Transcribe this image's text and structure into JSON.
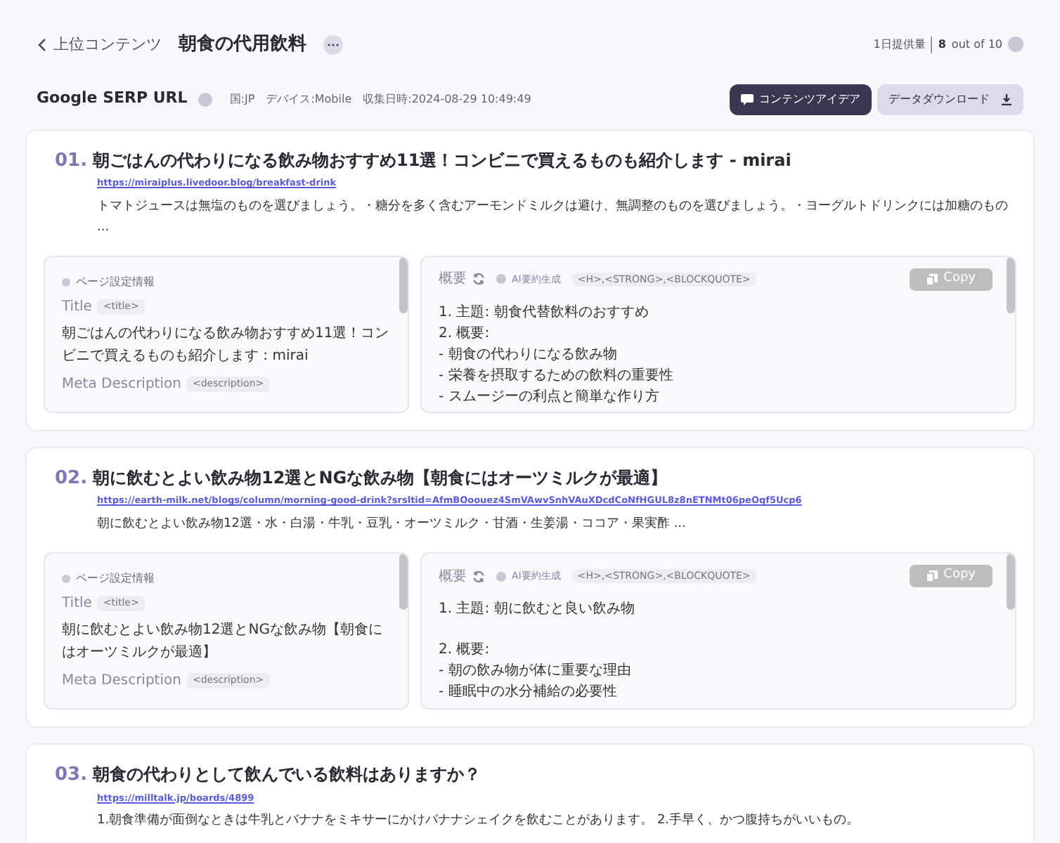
{
  "header": {
    "back_label": "上位コンテンツ",
    "title": "朝食の代用飲料",
    "quota_label": "1日提供量",
    "quota_used": "8",
    "quota_total": "out of 10"
  },
  "serp": {
    "title": "Google SERP URL",
    "country": "国:JP",
    "device": "デバイス:Mobile",
    "collected": "収集日時:2024-08-29 10:49:49",
    "idea_button": "コンテンツアイデア",
    "download_button": "データダウンロード"
  },
  "results": [
    {
      "rank": "01.",
      "title": "朝ごはんの代わりになる飲み物おすすめ11選！コンビニで買えるものも紹介します - mirai",
      "url": "https://miraiplus.livedoor.blog/breakfast-drink",
      "snippet": "トマトジュースは無塩のものを選びましょう。・糖分を多く含むアーモンドミルクは避け、無調整のものを選びましょう。・ヨーグルトドリンクには加糖のもの ...",
      "page_info": {
        "label": "ページ設定情報",
        "title_label": "Title",
        "title_tag": "<title>",
        "title_text": "朝ごはんの代わりになる飲み物おすすめ11選！コンビニで買えるものも紹介します : mirai",
        "meta_label": "Meta Description",
        "meta_tag": "<description>"
      },
      "summary": {
        "label": "概要",
        "ai_label": "AI要約生成",
        "tags": "<H>,<STRONG>,<BLOCKQUOTE>",
        "copy": "Copy",
        "paragraphs": [
          [
            "1. 主題: 朝食代替飲料のおすすめ",
            "2. 概要:",
            "- 朝食の代わりになる飲み物",
            "- 栄養を摂取するための飲料の重要性",
            "- スムージーの利点と簡単な作り方"
          ]
        ]
      }
    },
    {
      "rank": "02.",
      "title": "朝に飲むとよい飲み物12選とNGな飲み物【朝食にはオーツミルクが最適】",
      "url": "https://earth-milk.net/blogs/column/morning-good-drink?srsltid=AfmBOoouez4SmVAwvSnhVAuXDcdCoNfHGUL8z8nETNMt06peOqf5Ucp6",
      "snippet": "朝に飲むとよい飲み物12選・水・白湯・牛乳・豆乳・オーツミルク・甘酒・生姜湯・ココア・果実酢 ...",
      "page_info": {
        "label": "ページ設定情報",
        "title_label": "Title",
        "title_tag": "<title>",
        "title_text": "朝に飲むとよい飲み物12選とNGな飲み物【朝食にはオーツミルクが最適】",
        "meta_label": "Meta Description",
        "meta_tag": "<description>"
      },
      "summary": {
        "label": "概要",
        "ai_label": "AI要約生成",
        "tags": "<H>,<STRONG>,<BLOCKQUOTE>",
        "copy": "Copy",
        "paragraphs": [
          [
            "1. 主題: 朝に飲むと良い飲み物"
          ],
          [
            "2. 概要:",
            "- 朝の飲み物が体に重要な理由",
            "- 睡眠中の水分補給の必要性"
          ]
        ]
      }
    },
    {
      "rank": "03.",
      "title": "朝食の代わりとして飲んでいる飲料はありますか？",
      "url": "https://milltalk.jp/boards/4899",
      "snippet": "1.朝食準備が面倒なときは牛乳とバナナをミキサーにかけバナナシェイクを飲むことがあります。 2.手早く、かつ腹持ちがいいもの。"
    }
  ]
}
